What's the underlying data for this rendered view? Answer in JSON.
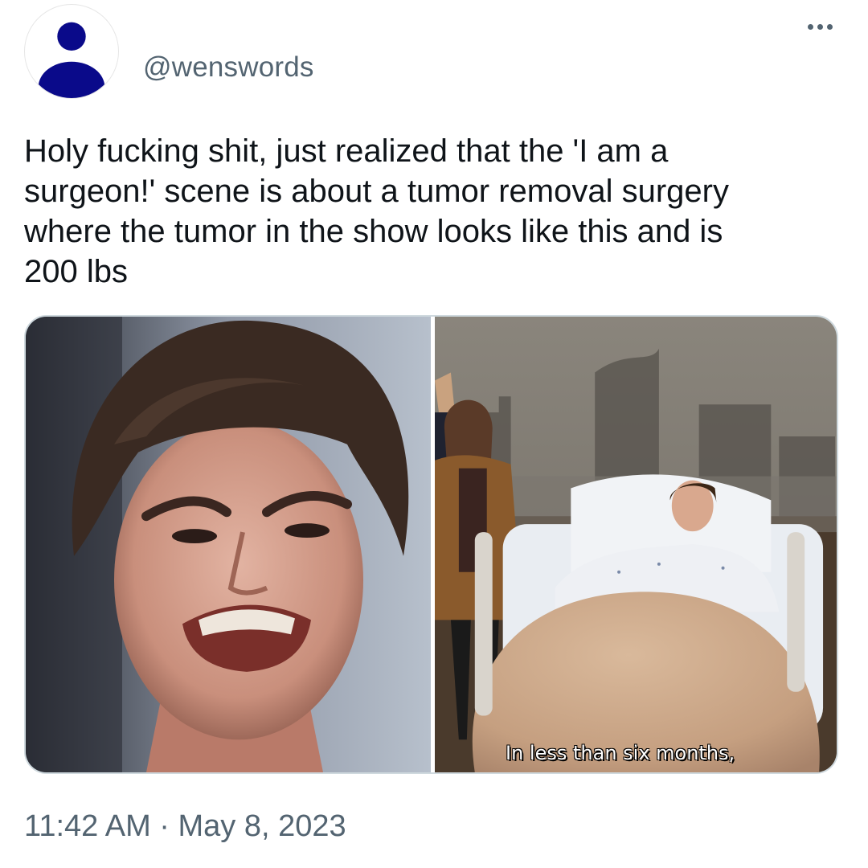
{
  "author": {
    "handle": "@wenswords",
    "avatar_icon": "default-profile-icon",
    "avatar_color": "#0a0a8a"
  },
  "menu": {
    "icon": "more-icon"
  },
  "tweet": {
    "text": "Holy fucking shit, just realized that the 'I am a\nsurgeon!' scene is about a tumor removal surgery\nwhere the tumor in the show looks like this and is\n200 lbs",
    "timestamp": "11:42 AM · May 8, 2023"
  },
  "media": {
    "subtitle": "In less than six months,"
  },
  "colors": {
    "text": "#0f1419",
    "secondary": "#536471",
    "border": "#cfd9de"
  }
}
